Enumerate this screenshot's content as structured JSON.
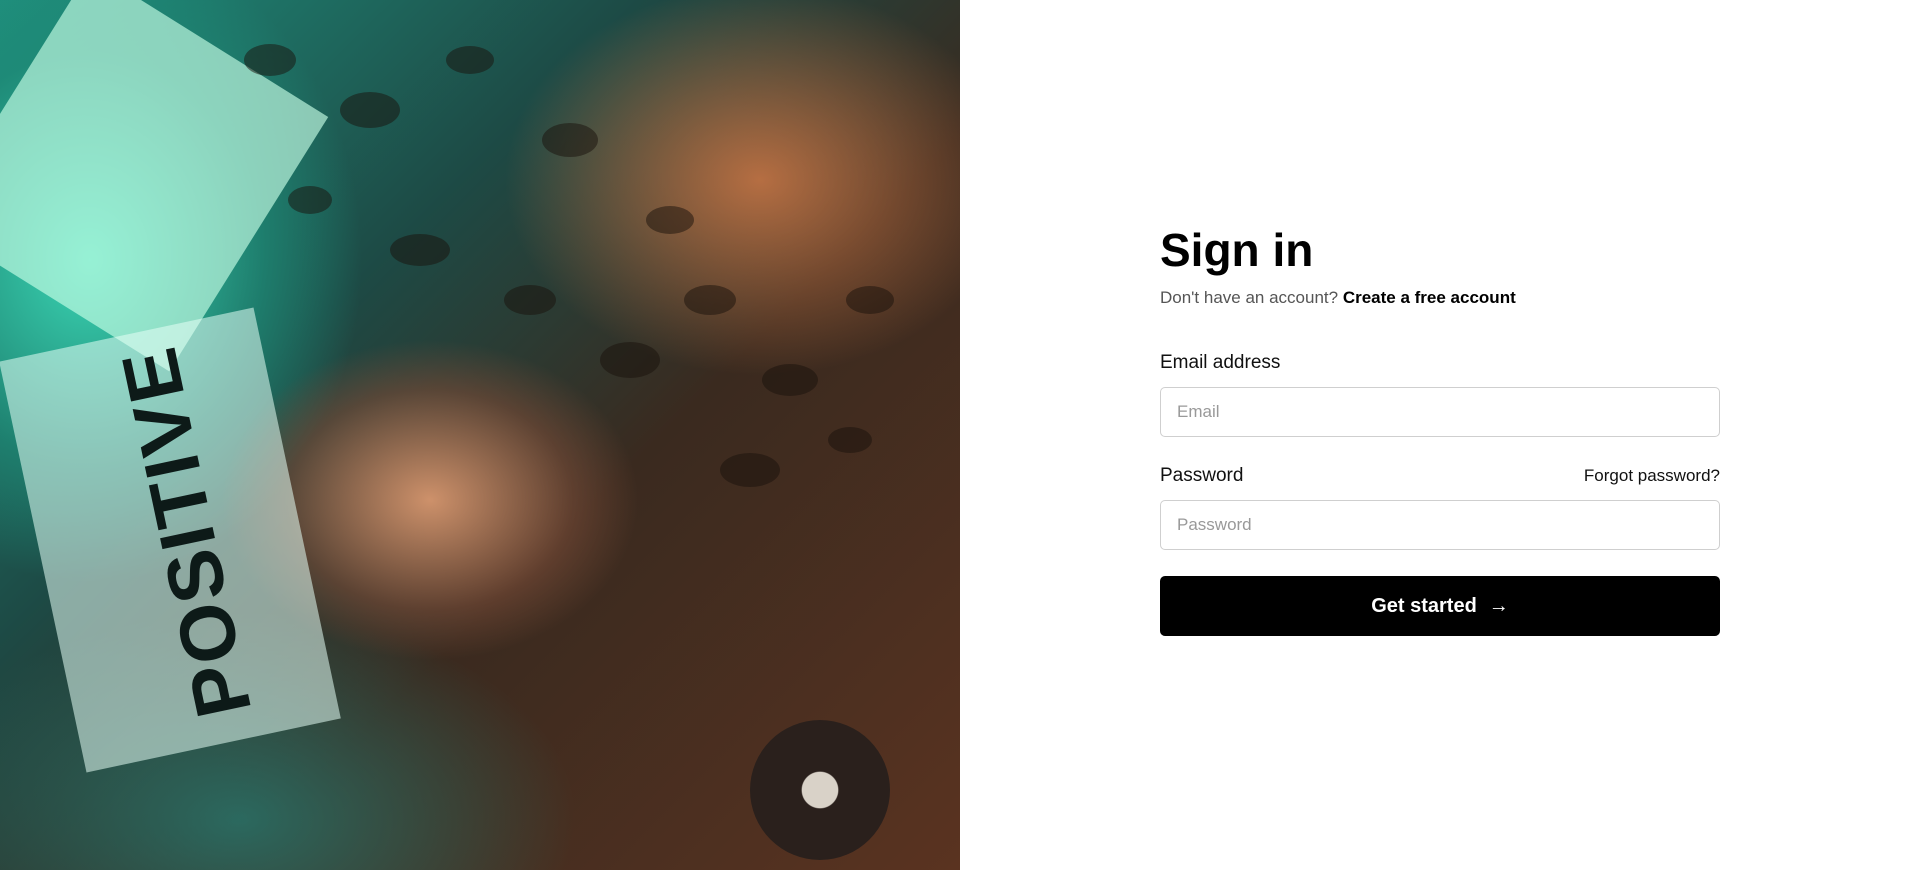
{
  "hero": {
    "image_description": "Person lying on records with headphones, leopard print shirt",
    "poster_word": "POSITIVE"
  },
  "signin": {
    "title": "Sign in",
    "subtitle_prefix": "Don't have an account?",
    "create_account_link": "Create a free account",
    "email_label": "Email address",
    "email_placeholder": "Email",
    "password_label": "Password",
    "forgot_password_link": "Forgot password?",
    "password_placeholder": "Password",
    "submit_label": "Get started",
    "submit_icon": "arrow-right-icon"
  },
  "colors": {
    "button_bg": "#000000",
    "button_text": "#ffffff",
    "border": "#cfcfcf"
  }
}
